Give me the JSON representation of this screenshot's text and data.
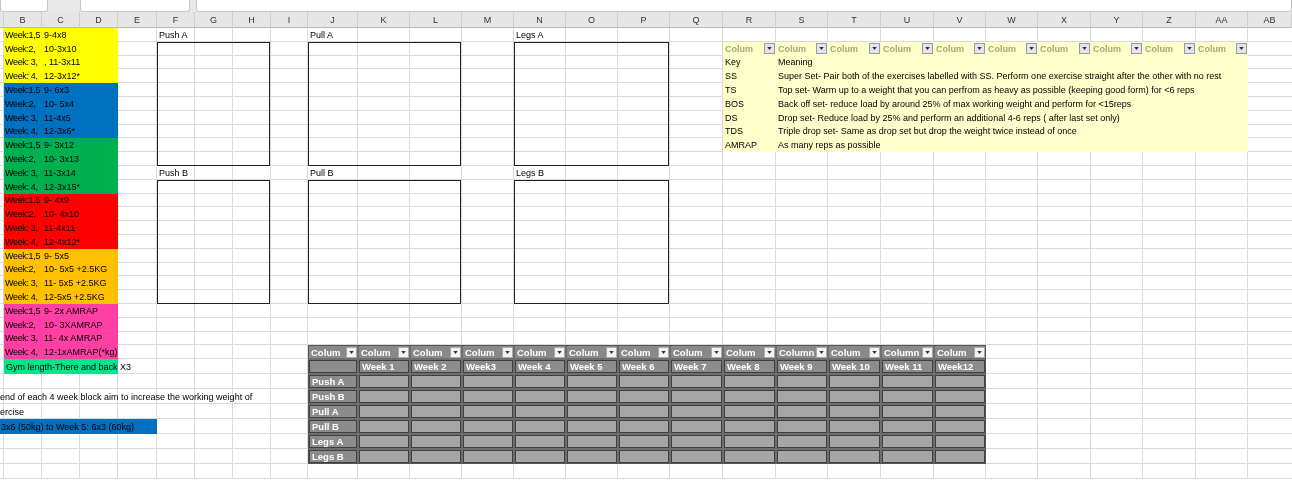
{
  "column_headers": [
    "B",
    "C",
    "D",
    "E",
    "F",
    "G",
    "H",
    "I",
    "J",
    "K",
    "L",
    "M",
    "N",
    "O",
    "P",
    "Q",
    "R",
    "S",
    "T",
    "U",
    "V",
    "W",
    "X",
    "Y",
    "Z",
    "AA",
    "AB"
  ],
  "week_blocks": [
    {
      "color": "#ffff00",
      "rows": [
        {
          "week": "Week:1,5",
          "reps": "9-4x8"
        },
        {
          "week": "Week:2,",
          "reps": "10-3x10"
        },
        {
          "week": "Week: 3,",
          "reps": ", 11-3x11"
        },
        {
          "week": "Week: 4,",
          "reps": "12-3x12*"
        }
      ]
    },
    {
      "color": "#0070c0",
      "rows": [
        {
          "week": "Week:1,5",
          "reps": "9- 6x3"
        },
        {
          "week": "Week:2,",
          "reps": "10- 5x4"
        },
        {
          "week": "Week: 3,",
          "reps": "11-4x5"
        },
        {
          "week": "Week: 4,",
          "reps": "12-3x6*"
        }
      ]
    },
    {
      "color": "#00b050",
      "rows": [
        {
          "week": "Week:1,5",
          "reps": "9- 3x12"
        },
        {
          "week": "Week:2,",
          "reps": "10- 3x13"
        },
        {
          "week": "Week: 3,",
          "reps": "11-3x14"
        },
        {
          "week": "Week: 4,",
          "reps": "12-3x15*"
        }
      ]
    },
    {
      "color": "#ff0000",
      "rows": [
        {
          "week": "Week:1,5",
          "reps": "9- 4x9"
        },
        {
          "week": "Week:2,",
          "reps": "10- 4x10"
        },
        {
          "week": "Week: 3,",
          "reps": "11-4x11"
        },
        {
          "week": "Week: 4,",
          "reps": "12-4x12*"
        }
      ]
    },
    {
      "color": "#ffc000",
      "rows": [
        {
          "week": "Week:1,5",
          "reps": "9- 5x5"
        },
        {
          "week": "Week:2,",
          "reps": "10- 5x5 +2.5KG"
        },
        {
          "week": "Week: 3,",
          "reps": "11- 5x5 +2.5KG"
        },
        {
          "week": "Week: 4,",
          "reps": "12-5x5 +2.5KG"
        }
      ]
    },
    {
      "color": "#ff3fa4",
      "rows": [
        {
          "week": "Week:1,5",
          "reps": "9- 2x AMRAP"
        },
        {
          "week": "Week:2,",
          "reps": "10- 3XAMRAP"
        },
        {
          "week": "Week: 3,",
          "reps": "11- 4x AMRAP"
        },
        {
          "week": "Week: 4,",
          "reps": "12-1xAMRAP(*kg)"
        }
      ]
    }
  ],
  "gym_row": "Gym length-There and back X3",
  "note_lines": [
    "end of each 4 week block aim to increase the working weight of",
    "ercise"
  ],
  "example": "3x6 (50kg) to Week 5: 6x3 (60kg)",
  "workout_boxes": [
    {
      "label": "Push A"
    },
    {
      "label": "Pull A"
    },
    {
      "label": "Legs A"
    },
    {
      "label": "Push B"
    },
    {
      "label": "Pull B"
    },
    {
      "label": "Legs B"
    }
  ],
  "key_table": {
    "filter_headers": [
      "Colum",
      "Colum",
      "Colum",
      "Colum",
      "Colum",
      "Colum",
      "Colum",
      "Colum",
      "Colum",
      "Colum"
    ],
    "rows": [
      {
        "key": "Key",
        "meaning": "Meaning"
      },
      {
        "key": "SS",
        "meaning": "Super Set- Pair both of the exercises labelled with SS. Perform one exercise straight after the other with no rest"
      },
      {
        "key": "TS",
        "meaning": "Top set- Warm up to a weight that you can perfrom as heavy as possible (keeping good form) for <6 reps"
      },
      {
        "key": "BOS",
        "meaning": "Back off set- reduce load by around 25% of max working weight and perform for <15reps"
      },
      {
        "key": "DS",
        "meaning": "Drop set- Reduce load by 25% and perform an additional 4-6 reps ( after last set only)"
      },
      {
        "key": "TDS",
        "meaning": "Triple drop set- Same as drop set but drop the weight twice instead of once"
      },
      {
        "key": "AMRAP",
        "meaning": "As many reps as possible"
      }
    ]
  },
  "tracker_table": {
    "filter_headers": [
      "Colum",
      "Colum",
      "Colum",
      "Colum",
      "Colum",
      "Colum",
      "Colum",
      "Colum",
      "Colum",
      "Column",
      "Colum",
      "Column",
      "Colum"
    ],
    "week_headers": [
      "Week 1",
      "Week 2",
      "Week3",
      "Week 4",
      "Week 5",
      "Week 6",
      "Week 7",
      "Week 8",
      "Week 9",
      "Week 10",
      "Week 11",
      "Week12"
    ],
    "rows": [
      "Push A",
      "Push B",
      "Pull A",
      "Pull B",
      "Legs A",
      "Legs B"
    ]
  }
}
